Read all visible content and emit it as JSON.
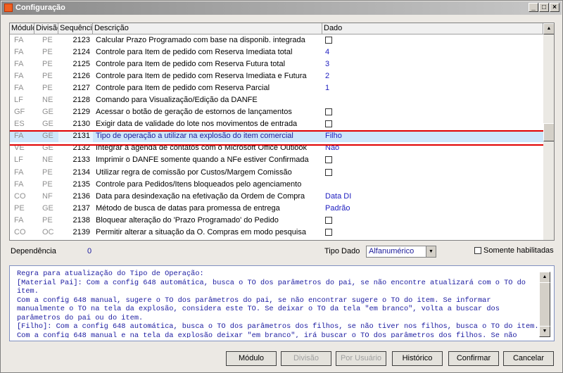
{
  "window": {
    "title": "Configuração"
  },
  "table": {
    "headers": [
      "Módulo",
      "Divisão",
      "Sequência",
      "Descrição",
      "Dado"
    ],
    "rows": [
      {
        "modulo": "FA",
        "divisao": "PE",
        "seq": "2123",
        "desc": "Calcular Prazo Programado com base na disponib. integrada",
        "dado": "",
        "check": true
      },
      {
        "modulo": "FA",
        "divisao": "PE",
        "seq": "2124",
        "desc": "Controle para Item de pedido com Reserva Imediata total",
        "dado": "4",
        "check": false
      },
      {
        "modulo": "FA",
        "divisao": "PE",
        "seq": "2125",
        "desc": "Controle para Item de pedido com Reserva Futura total",
        "dado": "3",
        "check": false
      },
      {
        "modulo": "FA",
        "divisao": "PE",
        "seq": "2126",
        "desc": "Controle para Item de pedido com Reserva Imediata e Futura",
        "dado": "2",
        "check": false
      },
      {
        "modulo": "FA",
        "divisao": "PE",
        "seq": "2127",
        "desc": "Controle para Item de pedido com Reserva Parcial",
        "dado": "1",
        "check": false
      },
      {
        "modulo": "LF",
        "divisao": "NE",
        "seq": "2128",
        "desc": "Comando para Visualização/Edição da DANFE",
        "dado": "",
        "check": false
      },
      {
        "modulo": "GF",
        "divisao": "GE",
        "seq": "2129",
        "desc": "Acessar o botão de geração de estornos de lançamentos",
        "dado": "",
        "check": true
      },
      {
        "modulo": "ES",
        "divisao": "GE",
        "seq": "2130",
        "desc": "Exigir data de validade do lote nos movimentos de entrada",
        "dado": "",
        "check": true
      },
      {
        "modulo": "FA",
        "divisao": "GE",
        "seq": "2131",
        "desc": "Tipo de operação a utilizar na explosão do item comercial",
        "dado": "Filho",
        "check": false,
        "selected": true
      },
      {
        "modulo": "VE",
        "divisao": "GE",
        "seq": "2132",
        "desc": "Integrar a agenda de contatos com o Microsoft Office Outlook",
        "dado": "Não",
        "check": false
      },
      {
        "modulo": "LF",
        "divisao": "NE",
        "seq": "2133",
        "desc": "Imprimir o DANFE somente quando a NFe estiver Confirmada",
        "dado": "",
        "check": true
      },
      {
        "modulo": "FA",
        "divisao": "PE",
        "seq": "2134",
        "desc": "Utilizar regra de comissão por Custos/Margem Comissão",
        "dado": "",
        "check": true
      },
      {
        "modulo": "FA",
        "divisao": "PE",
        "seq": "2135",
        "desc": "Controle para Pedidos/Itens bloqueados pelo agenciamento",
        "dado": "",
        "check": false
      },
      {
        "modulo": "CO",
        "divisao": "NF",
        "seq": "2136",
        "desc": "Data para desindexação na efetivação da Ordem de Compra",
        "dado": "Data DI",
        "check": false
      },
      {
        "modulo": "PE",
        "divisao": "GE",
        "seq": "2137",
        "desc": "Método de busca de datas para promessa de entrega",
        "dado": "Padrão",
        "check": false
      },
      {
        "modulo": "FA",
        "divisao": "PE",
        "seq": "2138",
        "desc": "Bloquear alteração do 'Prazo Programado' do Pedido",
        "dado": "",
        "check": true
      },
      {
        "modulo": "CO",
        "divisao": "OC",
        "seq": "2139",
        "desc": "Permitir alterar a situação da O. Compras em modo pesquisa",
        "dado": "",
        "check": true
      }
    ]
  },
  "footer": {
    "dependencia_label": "Dependência",
    "dependencia_value": "0",
    "tipo_dado_label": "Tipo Dado",
    "tipo_dado_value": "Alfanumérico",
    "somente_label": "Somente habilitadas"
  },
  "memo": "Regra para atualização do Tipo de Operação:\n[Material Pai]: Com a config 648 automática, busca o TO dos parâmetros do pai, se não encontre atualizará com o TO do item.\nCom a config 648 manual, sugere o TO dos parâmetros do pai, se não encontrar sugere o TO do item. Se informar manualmente o TO na tela da explosão, considera este TO. Se deixar o TO da tela \"em branco\", volta a buscar dos parâmetros do pai ou do item.\n[Filho]: Com a config 648 automática, busca o TO dos parâmetros dos filhos, se não tiver nos filhos, busca o TO do item.\nCom a config 648 manual e na tela da explosão deixar \"em branco\", irá buscar o TO dos parâmetros dos filhos. Se não tiver TO nos parâmetros dos filhos, atualizará com o TO do item. Se informado o TO na tela, será atualizado com este.",
  "buttons": {
    "modulo": "Módulo",
    "divisao": "Divisão",
    "por_usuario": "Por Usuário",
    "historico": "Histórico",
    "confirmar": "Confirmar",
    "cancelar": "Cancelar"
  }
}
